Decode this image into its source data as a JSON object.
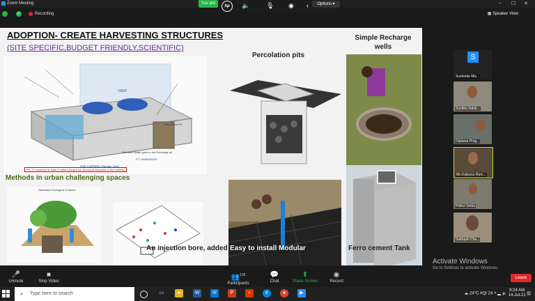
{
  "window": {
    "title": "Zoom Meeting"
  },
  "topbar": {
    "recording": "Recording",
    "speaker_view": "Speaker View",
    "viewing_tag": "You are",
    "options": "Options"
  },
  "slide": {
    "title": "ADOPTION- CREATE HARVESTING STRUCTURES",
    "subtitle": "(SITE SPECIFIC,BUDGET FRIENDLY,SCIENTIFIC)",
    "diagram_note": "PS: To construct at least 3 meters away from structural elements of the building.",
    "diagram_labels": {
      "view": "VIEW",
      "tank": "ONE CARPARK (Storage Tank)",
      "flow": "Overflow Water goes to the Recharge pit",
      "recharge": "P.T. DIMENSION",
      "percolation": "Percolation Pit"
    },
    "methods": "Methods in urban challenging spaces",
    "bioswale_title": "Rainwater Ecological Channel",
    "injection": "An injection bore, added",
    "percolation": "Percolation pits",
    "modular": "Easy to install Modular",
    "wells": "Simple Recharge wells",
    "tank": "Ferro cement Tank"
  },
  "participants": [
    {
      "name": "Sushmita Mis...",
      "avatar": "S"
    },
    {
      "name": "Sunitha Induk..."
    },
    {
      "name": "Diploma Prog..."
    },
    {
      "name": "Ms.Kalpana Ram..."
    },
    {
      "name": "Prithvi Sinha"
    },
    {
      "name": "Subhash Cha..."
    }
  ],
  "watermark": {
    "title": "Activate Windows",
    "sub": "Go to Settings to activate Windows."
  },
  "toolbar": {
    "unmute": "Unmute",
    "stop_video": "Stop Video",
    "participants": "Participants",
    "participants_count": "135",
    "chat": "Chat",
    "share_screen": "Share Screen",
    "record": "Record",
    "leave": "Leave"
  },
  "taskbar": {
    "search_placeholder": "Type here to search",
    "weather": "24°C",
    "aqi": "AQI 24",
    "time": "9:24 AM",
    "date": "14-Jul-21"
  }
}
